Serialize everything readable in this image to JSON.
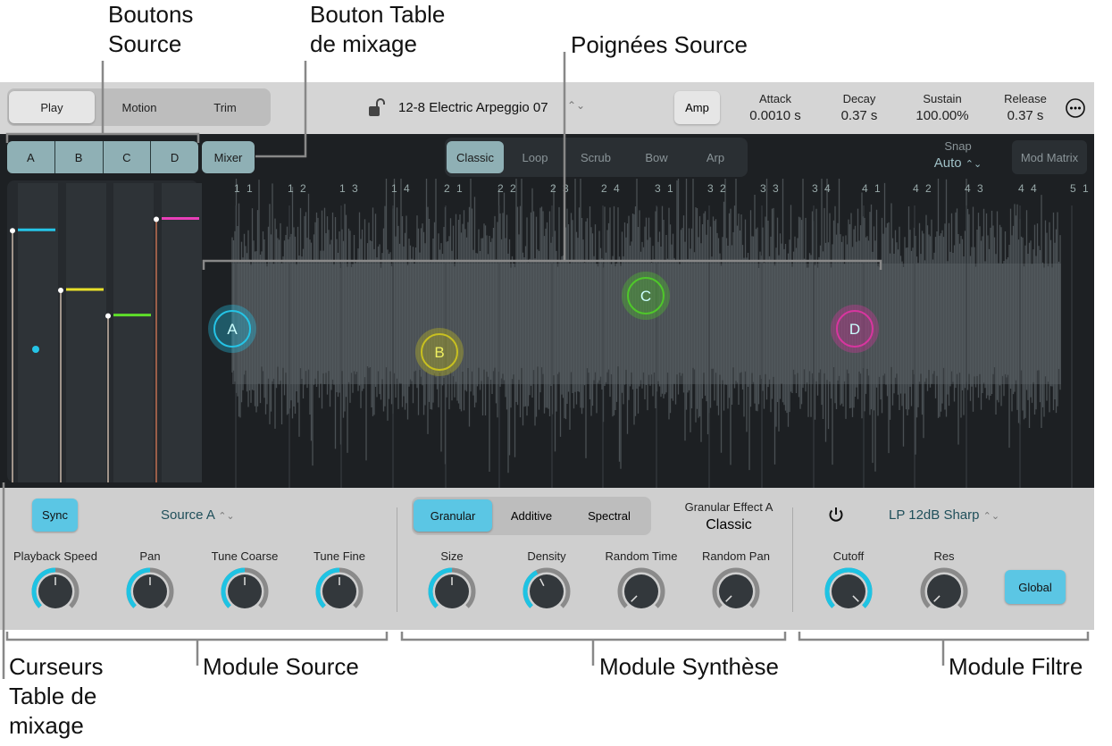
{
  "callouts": {
    "source_buttons": [
      "Boutons",
      "Source"
    ],
    "mixer_button": [
      "Bouton Table",
      "de mixage"
    ],
    "source_handles": "Poignées Source",
    "mixer_sliders": [
      "Curseurs",
      "Table de",
      "mixage"
    ],
    "source_module": "Module Source",
    "synth_module": "Module Synthèse",
    "filter_module": "Module Filtre"
  },
  "header": {
    "modes": [
      "Play",
      "Motion",
      "Trim"
    ],
    "active_mode": "Play",
    "preset": "12-8 Electric Arpeggio 07",
    "amp_label": "Amp",
    "envelope": [
      {
        "label": "Attack",
        "value": "0.0010 s"
      },
      {
        "label": "Decay",
        "value": "0.37 s"
      },
      {
        "label": "Sustain",
        "value": "100.00%"
      },
      {
        "label": "Release",
        "value": "0.37 s"
      }
    ]
  },
  "sources": [
    "A",
    "B",
    "C",
    "D"
  ],
  "mixer_label": "Mixer",
  "play_modes": [
    "Classic",
    "Loop",
    "Scrub",
    "Bow",
    "Arp"
  ],
  "active_play_mode": "Classic",
  "snap": {
    "label": "Snap",
    "value": "Auto"
  },
  "mod_matrix_label": "Mod Matrix",
  "ruler": [
    "1 1",
    "1 2",
    "1 3",
    "1 4",
    "2 1",
    "2 2",
    "2 3",
    "2 4",
    "3 1",
    "3 2",
    "3 3",
    "3 4",
    "4 1",
    "4 2",
    "4 3",
    "4 4",
    "5 1"
  ],
  "mixer_levels": [
    {
      "source": "A",
      "level": 0.88,
      "color": "#25c4e6"
    },
    {
      "source": "B",
      "level": 0.67,
      "color": "#e8e02a"
    },
    {
      "source": "C",
      "level": 0.58,
      "color": "#5fe02a"
    },
    {
      "source": "D",
      "level": 0.92,
      "color": "#e83fb8"
    }
  ],
  "handles": [
    {
      "label": "A",
      "color": "#25c4e6"
    },
    {
      "label": "B",
      "color": "#c8c020"
    },
    {
      "label": "C",
      "color": "#4fc82a"
    },
    {
      "label": "D",
      "color": "#d8359f"
    }
  ],
  "source_module": {
    "sync_label": "Sync",
    "source_select": "Source A",
    "knobs": [
      {
        "label": "Playback Speed",
        "value": 0.5
      },
      {
        "label": "Pan",
        "value": 0.5
      },
      {
        "label": "Tune Coarse",
        "value": 0.5
      },
      {
        "label": "Tune Fine",
        "value": 0.5
      }
    ]
  },
  "synth_module": {
    "types": [
      "Granular",
      "Additive",
      "Spectral"
    ],
    "active_type": "Granular",
    "effect_label": "Granular Effect A",
    "effect_value": "Classic",
    "knobs": [
      {
        "label": "Size",
        "value": 0.5
      },
      {
        "label": "Density",
        "value": 0.4
      },
      {
        "label": "Random Time",
        "value": 0
      },
      {
        "label": "Random Pan",
        "value": 0
      }
    ]
  },
  "filter_module": {
    "filter_type": "LP 12dB Sharp",
    "global_label": "Global",
    "knobs": [
      {
        "label": "Cutoff",
        "value": 1.0
      },
      {
        "label": "Res",
        "value": 0
      }
    ]
  },
  "colors": {
    "accent": "#5bc6e4",
    "teal": "#8fb0b5",
    "panel_dark": "#1d2023"
  }
}
